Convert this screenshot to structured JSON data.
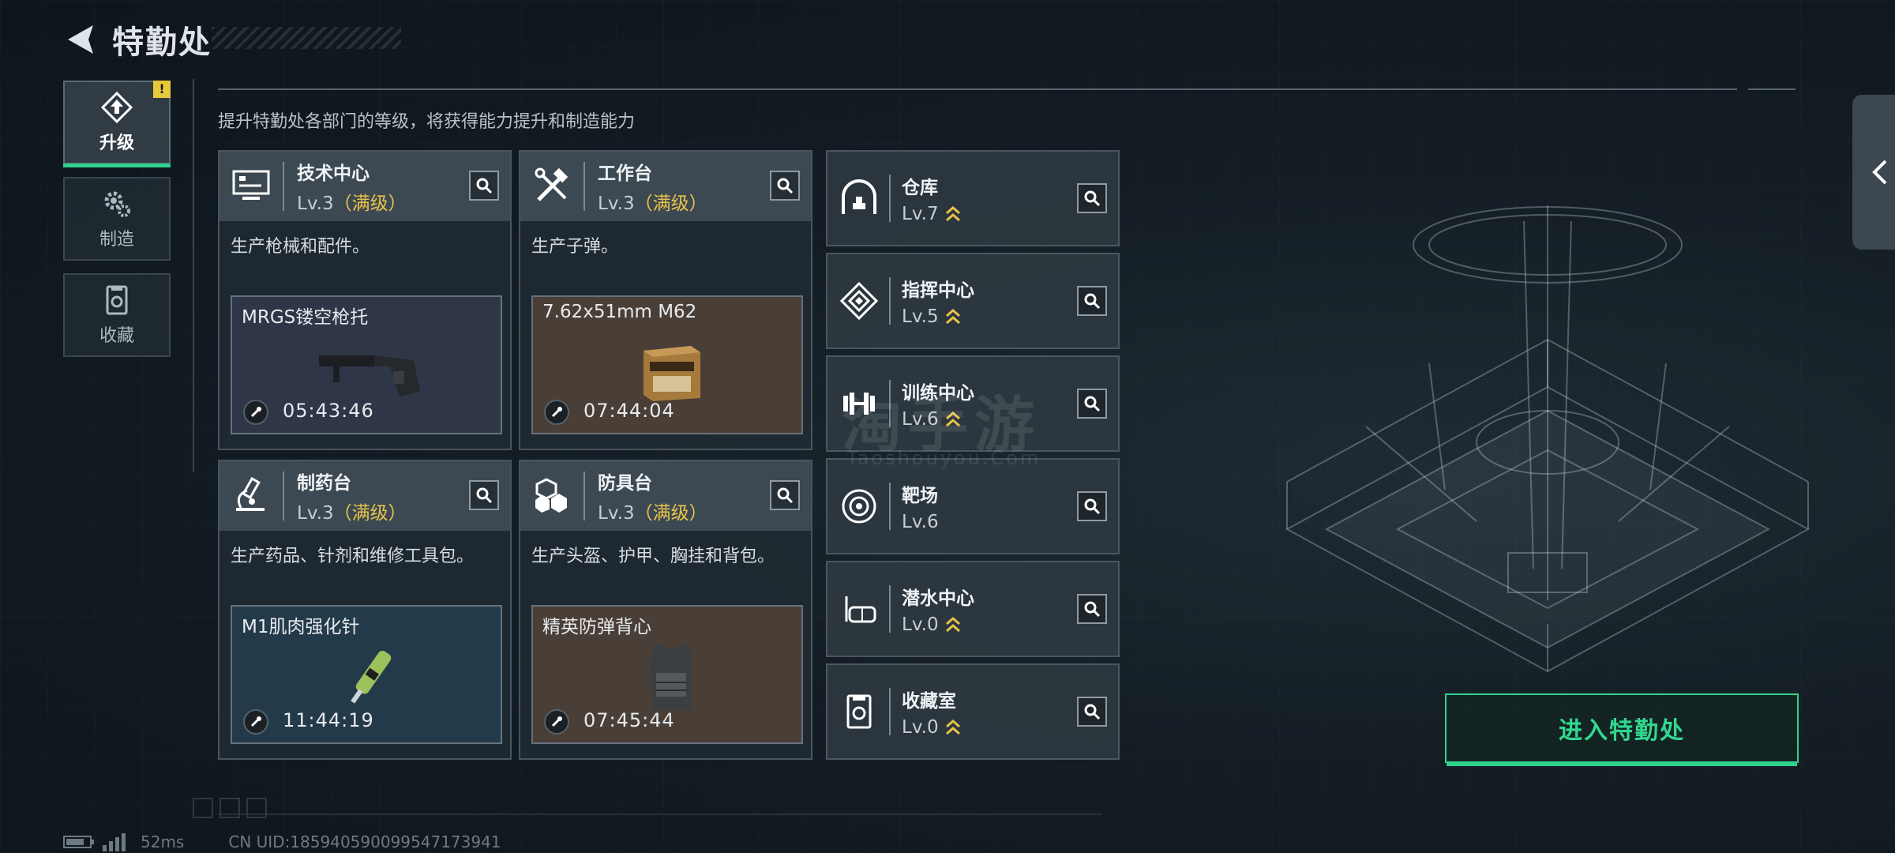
{
  "header": {
    "title": "特勤处"
  },
  "nav": {
    "items": [
      {
        "label": "升级",
        "active": true,
        "badge": "!"
      },
      {
        "label": "制造"
      },
      {
        "label": "收藏"
      }
    ]
  },
  "description": "提升特勤处各部门的等级，将获得能力提升和制造能力",
  "cards": [
    {
      "name": "技术中心",
      "level": "Lv.3",
      "max": "（满级）",
      "desc": "生产枪械和配件。",
      "craft": {
        "name": "MRGS镂空枪托",
        "timer": "05:43:46"
      }
    },
    {
      "name": "工作台",
      "level": "Lv.3",
      "max": "（满级）",
      "desc": "生产子弹。",
      "craft": {
        "name": "7.62x51mm M62",
        "timer": "07:44:04"
      }
    },
    {
      "name": "制药台",
      "level": "Lv.3",
      "max": "（满级）",
      "desc": "生产药品、针剂和维修工具包。",
      "craft": {
        "name": "M1肌肉强化针",
        "timer": "11:44:19"
      }
    },
    {
      "name": "防具台",
      "level": "Lv.3",
      "max": "（满级）",
      "desc": "生产头盔、护甲、胸挂和背包。",
      "craft": {
        "name": "精英防弹背心",
        "timer": "07:45:44"
      }
    }
  ],
  "facilities": [
    {
      "name": "仓库",
      "level": "Lv.7",
      "upgradable": true
    },
    {
      "name": "指挥中心",
      "level": "Lv.5",
      "upgradable": true
    },
    {
      "name": "训练中心",
      "level": "Lv.6",
      "upgradable": true
    },
    {
      "name": "靶场",
      "level": "Lv.6",
      "upgradable": false
    },
    {
      "name": "潜水中心",
      "level": "Lv.0",
      "upgradable": true
    },
    {
      "name": "收藏室",
      "level": "Lv.0",
      "upgradable": true
    }
  ],
  "watermark": {
    "main": "淘手游",
    "sub": "Taoshouyou.Com"
  },
  "enter_button": "进入特勤处",
  "status": {
    "ping": "52ms",
    "uid": "CN UID:1859405900995471739​41"
  },
  "colors": {
    "accent": "#2ed28a",
    "max_level": "#e8c34a",
    "upgrade_arrow": "#e8c34a"
  }
}
